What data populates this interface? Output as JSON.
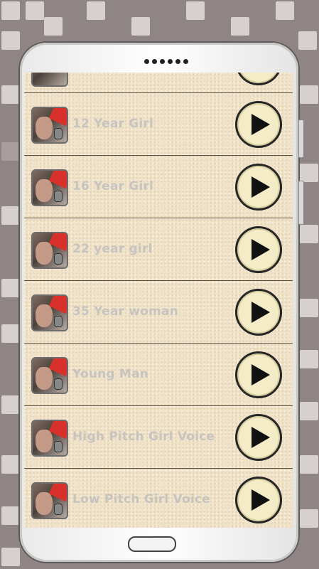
{
  "app": {
    "accent_colors": {
      "background": "#8f8584",
      "screen": "#f1e3c8",
      "text": "#c7c4c0",
      "play_fill": "#f3ecc6"
    }
  },
  "voices": [
    {
      "label": "12 Year Girl",
      "action_icon": "play-icon"
    },
    {
      "label": "16 Year Girl",
      "action_icon": "play-icon"
    },
    {
      "label": "22 year girl",
      "action_icon": "play-icon"
    },
    {
      "label": "35 Year woman",
      "action_icon": "play-icon"
    },
    {
      "label": "Young Man",
      "action_icon": "play-icon"
    },
    {
      "label": "High Pitch Girl Voice",
      "action_icon": "play-icon"
    },
    {
      "label": "Low Pitch Girl Voice",
      "action_icon": "play-icon"
    }
  ]
}
